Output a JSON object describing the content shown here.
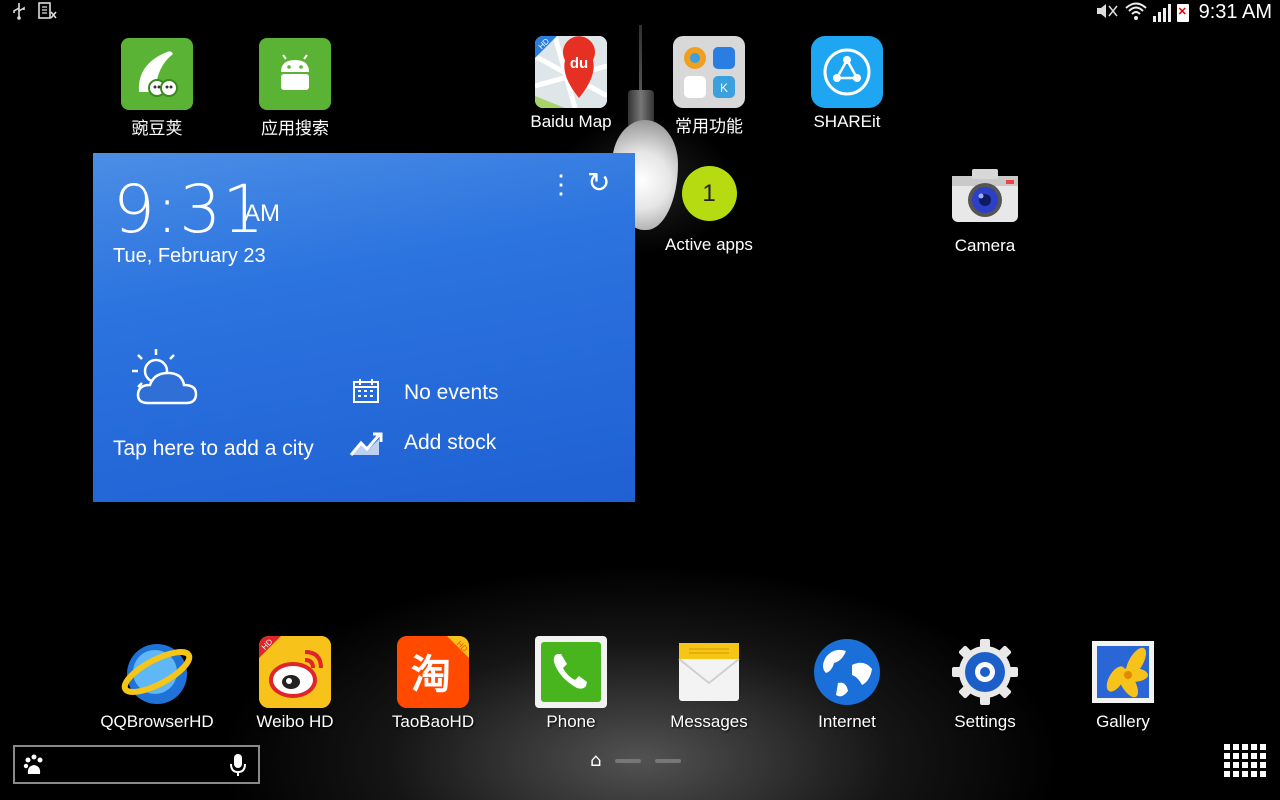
{
  "status_bar": {
    "time": "9:31 AM",
    "left_icons": [
      "usb-icon",
      "sim-error-icon"
    ],
    "right_icons": [
      "mute-icon",
      "wifi-icon",
      "signal-icon",
      "battery-error-icon"
    ]
  },
  "top_apps": [
    {
      "label": "豌豆荚",
      "icon": "wandoujia-icon",
      "color": "#5bb335"
    },
    {
      "label": "应用搜索",
      "icon": "android-icon",
      "color": "#5bb335"
    },
    {
      "label": "Baidu Map",
      "icon": "baidu-map-icon",
      "badge": "HD",
      "mark": "du"
    },
    {
      "label": "常用功能",
      "icon": "folder-icon"
    },
    {
      "label": "SHAREit",
      "icon": "shareit-icon",
      "color": "#1ea6f2"
    }
  ],
  "widget": {
    "time": "9:31",
    "ampm": "AM",
    "date": "Tue, February 23",
    "city_prompt": "Tap here to add a city",
    "events": "No events",
    "stock": "Add stock",
    "background": "#2c74df"
  },
  "active_apps": {
    "count": "1",
    "label": "Active apps",
    "color": "#b6db11"
  },
  "camera": {
    "label": "Camera",
    "icon": "camera-icon"
  },
  "dock": [
    {
      "label": "QQBrowserHD",
      "icon": "qqbrowser-icon"
    },
    {
      "label": "Weibo HD",
      "icon": "weibo-icon",
      "badge": "HD"
    },
    {
      "label": "TaoBaoHD",
      "icon": "taobao-icon",
      "badge": "HD",
      "mark": "淘"
    },
    {
      "label": "Phone",
      "icon": "phone-icon"
    },
    {
      "label": "Messages",
      "icon": "messages-icon"
    },
    {
      "label": "Internet",
      "icon": "globe-icon"
    },
    {
      "label": "Settings",
      "icon": "gear-icon"
    },
    {
      "label": "Gallery",
      "icon": "gallery-icon"
    }
  ],
  "search_bar": {
    "left_icon": "baidu-paw-icon",
    "right_icon": "mic-icon"
  },
  "pager": {
    "pages": 3,
    "current": "home"
  }
}
